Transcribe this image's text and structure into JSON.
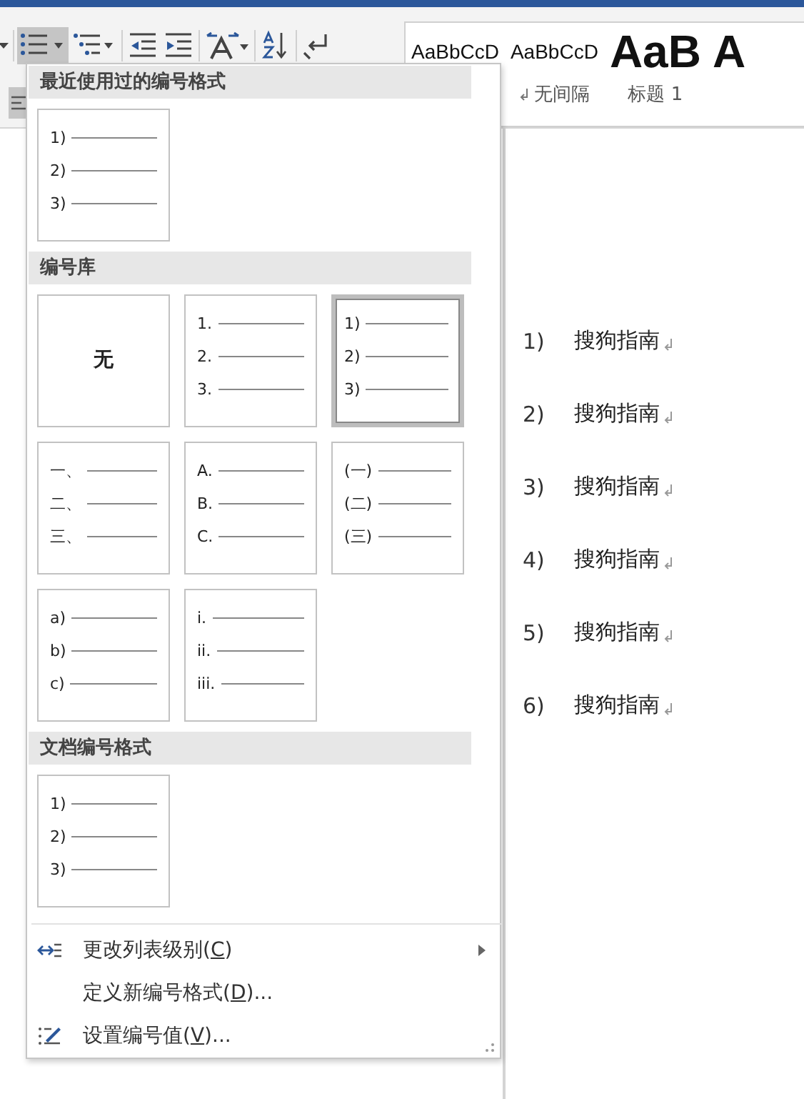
{
  "ribbon": {
    "tools": [
      {
        "kind": "caret",
        "selected": false
      },
      {
        "kind": "numbering",
        "selected": true
      },
      {
        "kind": "multilevel",
        "selected": false
      },
      {
        "kind": "decrease-indent",
        "selected": false
      },
      {
        "kind": "increase-indent",
        "selected": false
      },
      {
        "kind": "text-spacing",
        "selected": false
      },
      {
        "kind": "sort",
        "selected": false
      },
      {
        "kind": "marks",
        "selected": false
      }
    ],
    "row2_tools": [
      {
        "kind": "align",
        "selected": true
      }
    ],
    "styles": [
      {
        "preview": "AaBbCcD",
        "kind": "normal"
      },
      {
        "preview": "AaBbCcD",
        "kind": "normal",
        "name": "无间隔",
        "mark": true
      },
      {
        "preview": "AaB",
        "kind": "heading",
        "name": "标题 1"
      },
      {
        "preview": "A",
        "kind": "heading"
      }
    ]
  },
  "menu": {
    "sections": [
      {
        "title": "最近使用过的编号格式",
        "tiles": [
          {
            "kind": "list",
            "labels": [
              "1)",
              "2)",
              "3)"
            ],
            "selected": false
          }
        ]
      },
      {
        "title": "编号库",
        "tiles": [
          {
            "kind": "none",
            "label": "无",
            "selected": false
          },
          {
            "kind": "list",
            "labels": [
              "1.",
              "2.",
              "3."
            ],
            "selected": false
          },
          {
            "kind": "list",
            "labels": [
              "1)",
              "2)",
              "3)"
            ],
            "selected": true
          },
          {
            "kind": "list",
            "labels": [
              "一、",
              "二、",
              "三、"
            ],
            "selected": false
          },
          {
            "kind": "list",
            "labels": [
              "A.",
              "B.",
              "C."
            ],
            "selected": false
          },
          {
            "kind": "list",
            "labels": [
              "(一)",
              "(二)",
              "(三)"
            ],
            "selected": false
          },
          {
            "kind": "list",
            "labels": [
              "a)",
              "b)",
              "c)"
            ],
            "selected": false
          },
          {
            "kind": "list",
            "labels": [
              "i.",
              "ii.",
              "iii."
            ],
            "selected": false
          }
        ]
      },
      {
        "title": "文档编号格式",
        "tiles": [
          {
            "kind": "list",
            "labels": [
              "1)",
              "2)",
              "3)"
            ],
            "selected": false
          }
        ]
      }
    ],
    "items": [
      {
        "kind": "change-level",
        "before": "更改列表级别(",
        "key": "C",
        "after": ")",
        "submenu": true
      },
      {
        "kind": "plain",
        "before": "定义新编号格式(",
        "key": "D",
        "after": ")...",
        "submenu": false
      },
      {
        "kind": "set-value",
        "before": "设置编号值(",
        "key": "V",
        "after": ")...",
        "submenu": false
      }
    ]
  },
  "document": {
    "items": [
      {
        "number": "1)",
        "text": "搜狗指南"
      },
      {
        "number": "2)",
        "text": "搜狗指南"
      },
      {
        "number": "3)",
        "text": "搜狗指南"
      },
      {
        "number": "4)",
        "text": "搜狗指南"
      },
      {
        "number": "5)",
        "text": "搜狗指南"
      },
      {
        "number": "6)",
        "text": "搜狗指南"
      }
    ]
  }
}
